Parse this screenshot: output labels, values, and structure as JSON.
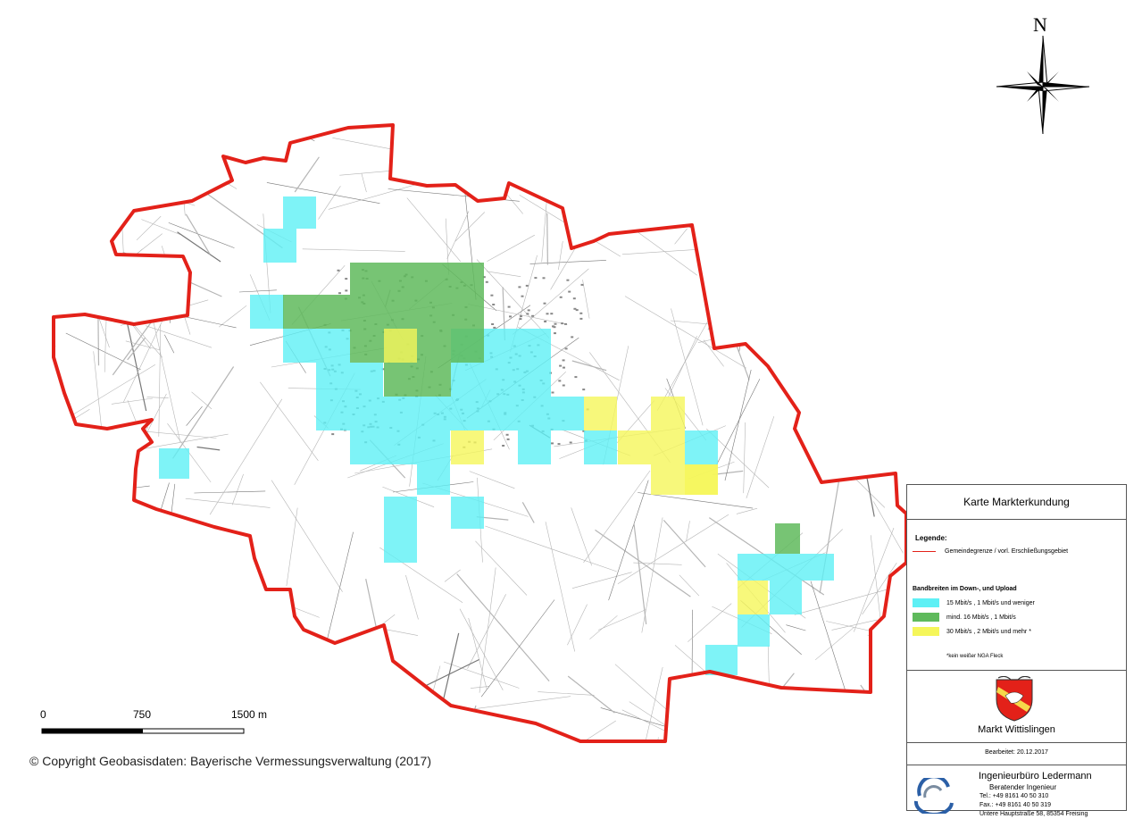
{
  "map": {
    "north_label": "N",
    "copyright": "© Copyright Geobasisdaten: Bayerische Vermessungsverwaltung (2017)",
    "scale_labels": [
      "0",
      "750",
      "1500 m"
    ],
    "colors": {
      "boundary": "#e32119",
      "slow": "#5ef0f5",
      "medium": "#5fba5c",
      "fast": "#f5f65a"
    }
  },
  "legend": {
    "title": "Karte Markterkundung",
    "heading": "Legende:",
    "boundary_label": "Gemeindegrenze / vorl. Erschließungsgebiet",
    "bandwidth_title": "Bandbreiten im Down-, und Upload",
    "items": [
      {
        "label": "15 Mbit/s , 1 Mbit/s und weniger",
        "color": "#5ef0f5"
      },
      {
        "label": "mind. 16 Mbit/s , 1 Mbit/s",
        "color": "#5fba5c"
      },
      {
        "label": "30 Mbit/s , 2 Mbit/s und mehr *",
        "color": "#f5f65a"
      }
    ],
    "note": "*kein weißer NGA Fleck",
    "town": "Markt Wittislingen",
    "date": "Bearbeitet: 20.12.2017",
    "office": {
      "name": "Ingenieurbüro Ledermann",
      "subtitle": "Beratender Ingenieur",
      "tel": "Tel.:  +49 8161 40 50 310",
      "fax": "Fax.: +49 8161 40 50 319",
      "address": "Untere Hauptstraße 58, 85354 Freising"
    }
  }
}
